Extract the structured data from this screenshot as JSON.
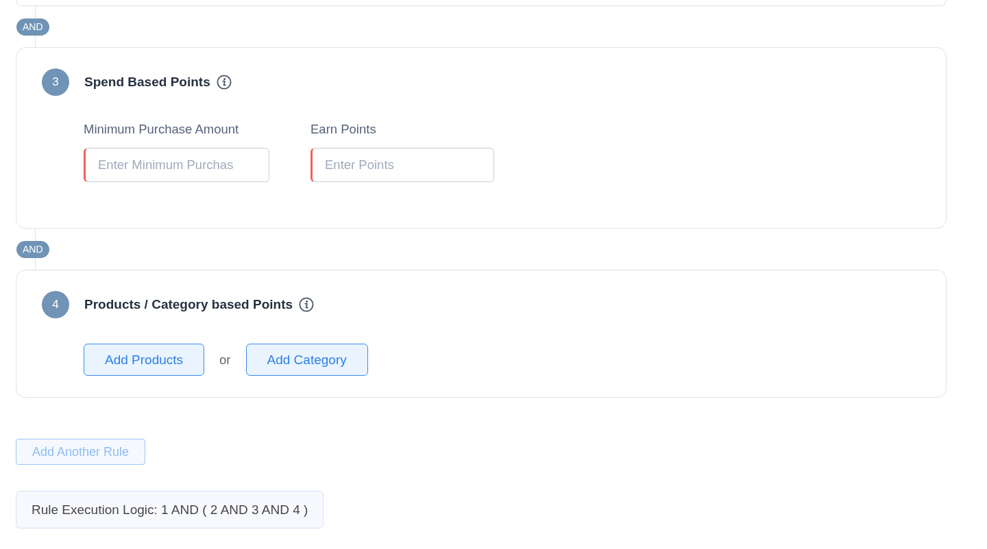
{
  "rules": [
    {
      "connector": "AND",
      "number": "3",
      "title": "Spend Based Points",
      "kind": "fields",
      "fields": [
        {
          "label": "Minimum Purchase Amount",
          "placeholder": "Enter Minimum Purchas",
          "required": true
        },
        {
          "label": "Earn Points",
          "placeholder": "Enter Points",
          "required": true
        }
      ]
    },
    {
      "connector": "AND",
      "number": "4",
      "title": "Products / Category based Points",
      "kind": "choice",
      "buttons": [
        {
          "label": "Add Products"
        },
        {
          "label": "Add Category"
        }
      ],
      "separator": "or"
    }
  ],
  "add_rule_button": {
    "label": "Add Another Rule",
    "disabled": true
  },
  "execution_logic": "Rule Execution Logic: 1 AND ( 2 AND 3 AND 4 )"
}
